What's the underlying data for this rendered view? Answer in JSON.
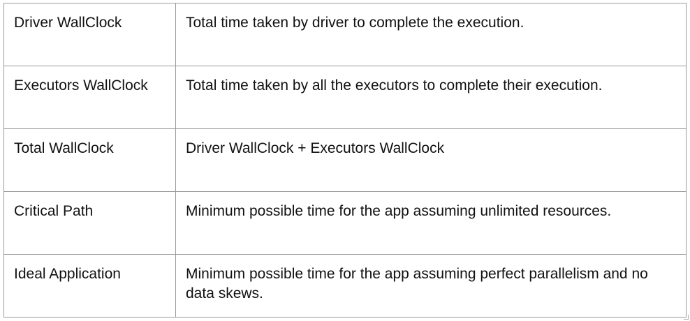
{
  "rows": [
    {
      "name": "Driver WallClock",
      "description": "Total time taken by driver to complete the execution."
    },
    {
      "name": "Executors WallClock",
      "description": "Total time taken by all the executors to complete their execution."
    },
    {
      "name": "Total WallClock",
      "description": "Driver WallClock + Executors WallClock"
    },
    {
      "name": "Critical Path",
      "description": "Minimum possible time for the app assuming unlimited resources."
    },
    {
      "name": "Ideal Application",
      "description": "Minimum possible time for the app assuming perfect parallelism and no data skews."
    }
  ]
}
